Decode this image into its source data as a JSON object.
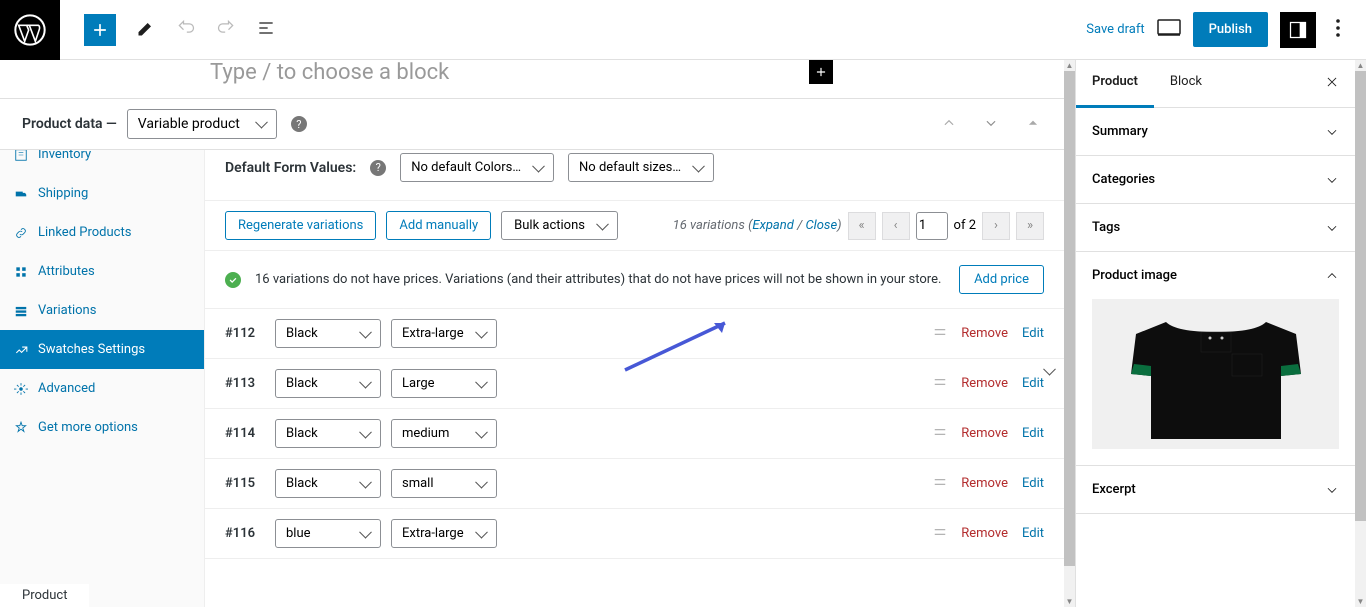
{
  "topbar": {
    "save_draft": "Save draft",
    "publish": "Publish"
  },
  "block_hint": "Type / to choose a block",
  "product_data": {
    "label": "Product data —",
    "type": "Variable product"
  },
  "pd_tabs": {
    "inventory": "Inventory",
    "shipping": "Shipping",
    "linked": "Linked Products",
    "attributes": "Attributes",
    "variations": "Variations",
    "swatches": "Swatches Settings",
    "advanced": "Advanced",
    "get_more": "Get more options"
  },
  "default_form": {
    "label": "Default Form Values:",
    "colors": "No default Colors…",
    "sizes": "No default sizes…"
  },
  "toolbar": {
    "regenerate": "Regenerate variations",
    "add_manually": "Add manually",
    "bulk_actions": "Bulk actions"
  },
  "pagination": {
    "count_text": "16 variations",
    "expand": "Expand",
    "close": "Close",
    "page": "1",
    "of": "of 2"
  },
  "notice": {
    "text": "16 variations do not have prices. Variations (and their attributes) that do not have prices will not be shown in your store.",
    "add_price": "Add price"
  },
  "variations": [
    {
      "id": "#112",
      "color": "Black",
      "size": "Extra-large"
    },
    {
      "id": "#113",
      "color": "Black",
      "size": "Large"
    },
    {
      "id": "#114",
      "color": "Black",
      "size": "medium"
    },
    {
      "id": "#115",
      "color": "Black",
      "size": "small"
    },
    {
      "id": "#116",
      "color": "blue",
      "size": "Extra-large"
    }
  ],
  "var_actions": {
    "remove": "Remove",
    "edit": "Edit"
  },
  "sidebar": {
    "tabs": {
      "product": "Product",
      "block": "Block"
    },
    "panels": {
      "summary": "Summary",
      "categories": "Categories",
      "tags": "Tags",
      "product_image": "Product image",
      "excerpt": "Excerpt"
    }
  },
  "footer": "Product"
}
